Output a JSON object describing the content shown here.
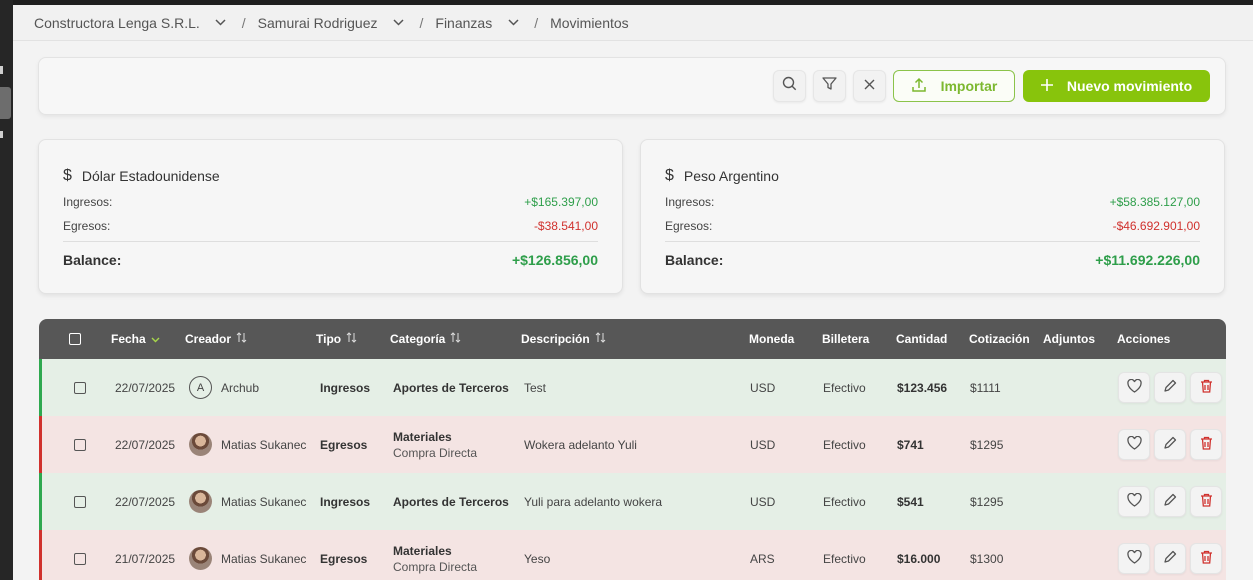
{
  "breadcrumb": [
    {
      "label": "Constructora Lenga S.R.L."
    },
    {
      "label": "Samurai Rodriguez"
    },
    {
      "label": "Finanzas"
    },
    {
      "label": "Movimientos"
    }
  ],
  "toolbar": {
    "import_label": "Importar",
    "new_label": "Nuevo movimiento"
  },
  "cards": [
    {
      "title": "Dólar Estadounidense",
      "income_label": "Ingresos:",
      "income": "+$165.397,00",
      "expense_label": "Egresos:",
      "expense": "-$38.541,00",
      "balance_label": "Balance:",
      "balance": "+$126.856,00"
    },
    {
      "title": "Peso Argentino",
      "income_label": "Ingresos:",
      "income": "+$58.385.127,00",
      "expense_label": "Egresos:",
      "expense": "-$46.692.901,00",
      "balance_label": "Balance:",
      "balance": "+$11.692.226,00"
    }
  ],
  "table": {
    "columns": {
      "fecha": "Fecha",
      "creador": "Creador",
      "tipo": "Tipo",
      "categoria": "Categoría",
      "descripcion": "Descripción",
      "moneda": "Moneda",
      "billetera": "Billetera",
      "cantidad": "Cantidad",
      "cotizacion": "Cotización",
      "adjuntos": "Adjuntos",
      "acciones": "Acciones"
    },
    "rows": [
      {
        "kind": "in",
        "fecha": "22/07/2025",
        "avatar": "A",
        "creador": "Archub",
        "tipo": "Ingresos",
        "categoria": "Aportes de Terceros",
        "subcategoria": "",
        "descripcion": "Test",
        "moneda": "USD",
        "billetera": "Efectivo",
        "cantidad": "$123.456",
        "cotizacion": "$1111"
      },
      {
        "kind": "out",
        "fecha": "22/07/2025",
        "avatar": "",
        "creador": "Matias Sukanec",
        "tipo": "Egresos",
        "categoria": "Materiales",
        "subcategoria": "Compra Directa",
        "descripcion": "Wokera adelanto Yuli",
        "moneda": "USD",
        "billetera": "Efectivo",
        "cantidad": "$741",
        "cotizacion": "$1295"
      },
      {
        "kind": "in",
        "fecha": "22/07/2025",
        "avatar": "",
        "creador": "Matias Sukanec",
        "tipo": "Ingresos",
        "categoria": "Aportes de Terceros",
        "subcategoria": "",
        "descripcion": "Yuli para adelanto wokera",
        "moneda": "USD",
        "billetera": "Efectivo",
        "cantidad": "$541",
        "cotizacion": "$1295"
      },
      {
        "kind": "out",
        "fecha": "21/07/2025",
        "avatar": "",
        "creador": "Matias Sukanec",
        "tipo": "Egresos",
        "categoria": "Materiales",
        "subcategoria": "Compra Directa",
        "descripcion": "Yeso",
        "moneda": "ARS",
        "billetera": "Efectivo",
        "cantidad": "$16.000",
        "cotizacion": "$1300"
      }
    ]
  },
  "colors": {
    "accent": "#88c40c",
    "income": "#2e9e4a",
    "expense": "#d0312d",
    "header": "#575757"
  }
}
